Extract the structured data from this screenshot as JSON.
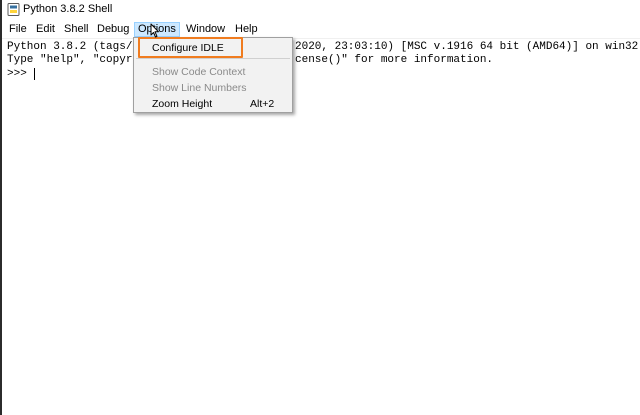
{
  "window": {
    "title": "Python 3.8.2 Shell"
  },
  "menubar": {
    "items": [
      "File",
      "Edit",
      "Shell",
      "Debug",
      "Options",
      "Window",
      "Help"
    ],
    "active": "Options"
  },
  "shell": {
    "line1_left": "Python 3.8.2 (tags/",
    "line1_right": "2020, 23:03:10) [MSC v.1916 64 bit (AMD64)] on win32",
    "line2_left": "Type \"help\", \"copyr",
    "line2_right": "cense()\" for more information.",
    "prompt": ">>> "
  },
  "options_menu": {
    "configure_idle": "Configure IDLE",
    "show_code_context": "Show Code Context",
    "show_line_numbers": "Show Line Numbers",
    "zoom_height": "Zoom Height",
    "zoom_height_shortcut": "Alt+2"
  },
  "colors": {
    "highlight": "#f07c1f",
    "menu_active_bg": "#cce8ff",
    "disabled_text": "#8a8a8a"
  },
  "icons": {
    "app": "python-icon",
    "pointer": "mouse-pointer-icon"
  }
}
